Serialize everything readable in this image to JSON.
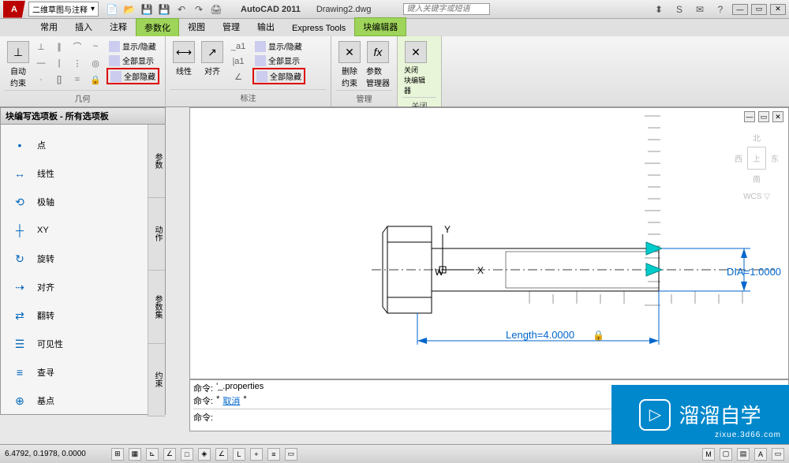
{
  "app": {
    "title": "AutoCAD 2011",
    "filename": "Drawing2.dwg",
    "logo": "A"
  },
  "workspace": {
    "name": "二维草图与注释"
  },
  "search": {
    "placeholder": "键入关键字或短语"
  },
  "tabs": {
    "items": [
      "常用",
      "插入",
      "注释",
      "参数化",
      "视图",
      "管理",
      "输出",
      "Express Tools",
      "块编辑器"
    ],
    "active_index": 3
  },
  "ribbon": {
    "panels": [
      {
        "name": "几何",
        "big": {
          "label": "自动\n约束"
        },
        "sub": [
          {
            "label": "显示/隐藏"
          },
          {
            "label": "全部显示"
          },
          {
            "label": "全部隐藏",
            "highlight": true
          }
        ]
      },
      {
        "name": "标注_linear",
        "big": {
          "label": "线性"
        }
      },
      {
        "name": "标注_align",
        "big": {
          "label": "对齐"
        }
      },
      {
        "name": "标注",
        "sub": [
          {
            "label": "显示/隐藏"
          },
          {
            "label": "全部显示"
          },
          {
            "label": "全部隐藏",
            "highlight": true
          }
        ]
      },
      {
        "name": "管理",
        "items": [
          {
            "label": "删除\n约束"
          },
          {
            "label": "参数\n管理器",
            "glyph": "fx"
          }
        ]
      },
      {
        "name": "关闭",
        "items": [
          {
            "label": "关闭\n块编辑器"
          }
        ]
      }
    ]
  },
  "palette": {
    "title": "块编写选项板 - 所有选项板",
    "items": [
      {
        "label": "点",
        "icon": "•"
      },
      {
        "label": "线性",
        "icon": "↔"
      },
      {
        "label": "极轴",
        "icon": "⟲"
      },
      {
        "label": "XY",
        "icon": "┼"
      },
      {
        "label": "旋转",
        "icon": "↻"
      },
      {
        "label": "对齐",
        "icon": "⇢"
      },
      {
        "label": "翻转",
        "icon": "⇄"
      },
      {
        "label": "可见性",
        "icon": "☰"
      },
      {
        "label": "查寻",
        "icon": "≡"
      },
      {
        "label": "基点",
        "icon": "⊕"
      }
    ],
    "tabs": [
      "参数",
      "动作",
      "参数集",
      "约束"
    ]
  },
  "drawing": {
    "ucs": {
      "x": "X",
      "y": "Y",
      "origin": "W"
    },
    "dim_length": "Length=4.0000",
    "dim_dia": "DIA=1.0000",
    "lock": "🔒"
  },
  "viewcube": {
    "north": "北",
    "west": "西",
    "east": "东",
    "south": "南",
    "wcs": "WCS ▽"
  },
  "cmdline": {
    "prefix": "命令:",
    "line1": "'_.properties",
    "line2_action": "取消",
    "line2_star": "*",
    "line3": ""
  },
  "status": {
    "coords": "6.4792, 0.1978, 0.0000"
  },
  "watermark": {
    "text": "溜溜自学",
    "url": "zixue.3d66.com",
    "play": "▷"
  }
}
